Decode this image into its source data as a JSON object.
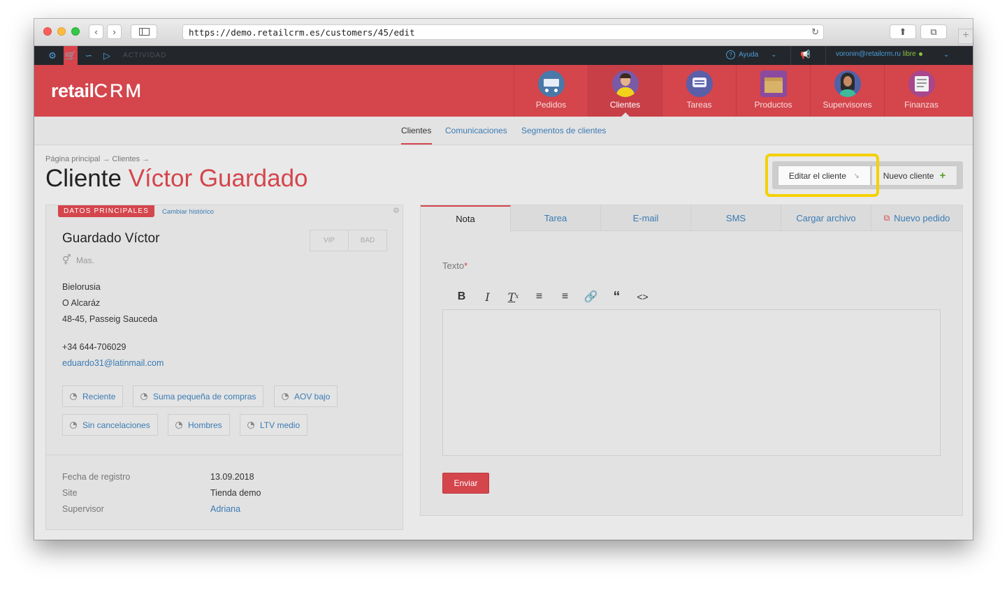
{
  "browser": {
    "url": "https://demo.retailcrm.es/customers/45/edit"
  },
  "topbar": {
    "activity_label": "ACTIVIDAD",
    "help_label": "Ayuda",
    "user_email": "voronin@retailcrm.ru",
    "user_status": "libre"
  },
  "header": {
    "logo_text": "retail",
    "logo_crm": "CRM",
    "nav": [
      {
        "label": "Pedidos",
        "icon": "cart-icon"
      },
      {
        "label": "Clientes",
        "icon": "customer-avatar-icon"
      },
      {
        "label": "Tareas",
        "icon": "tasks-icon"
      },
      {
        "label": "Productos",
        "icon": "box-icon"
      },
      {
        "label": "Supervisores",
        "icon": "manager-avatar-icon"
      },
      {
        "label": "Finanzas",
        "icon": "finance-icon"
      }
    ]
  },
  "subnav": {
    "items": [
      "Clientes",
      "Comunicaciones",
      "Segmentos de clientes"
    ],
    "active": "Clientes"
  },
  "breadcrumb": {
    "text": "Página principal → Clientes →"
  },
  "page": {
    "title_prefix": "Cliente",
    "title_name": "Víctor Guardado"
  },
  "actions": {
    "edit_label": "Editar el cliente",
    "new_label": "Nuevo cliente"
  },
  "customer": {
    "section_tag": "DATOS PRINCIPALES",
    "history_link": "Cambiar histórico",
    "name": "Guardado Víctor",
    "vip": "VIP",
    "bad": "BAD",
    "gender": "Mas.",
    "country": "Bielorusia",
    "city": "O Alcaráz",
    "street": "48-45, Passeig Sauceda",
    "phone": "+34 644-706029",
    "email": "eduardo31@latinmail.com",
    "segments": [
      "Reciente",
      "Suma pequeña de compras",
      "AOV bajo",
      "Sin cancelaciones",
      "Hombres",
      "LTV medio"
    ],
    "info": [
      {
        "label": "Fecha de registro",
        "value": "13.09.2018"
      },
      {
        "label": "Site",
        "value": "Tienda demo"
      },
      {
        "label": "Supervisor",
        "value": "Adriana"
      }
    ]
  },
  "note_panel": {
    "tabs": [
      "Nota",
      "Tarea",
      "E-mail",
      "SMS",
      "Cargar archivo",
      "Nuevo pedido"
    ],
    "active_tab": "Nota",
    "texto_label": "Texto",
    "required_mark": "*",
    "send_label": "Enviar"
  },
  "colors": {
    "brand_red": "#d4454c",
    "link_blue": "#3a7bb3",
    "highlight_yellow": "#f5d000"
  }
}
